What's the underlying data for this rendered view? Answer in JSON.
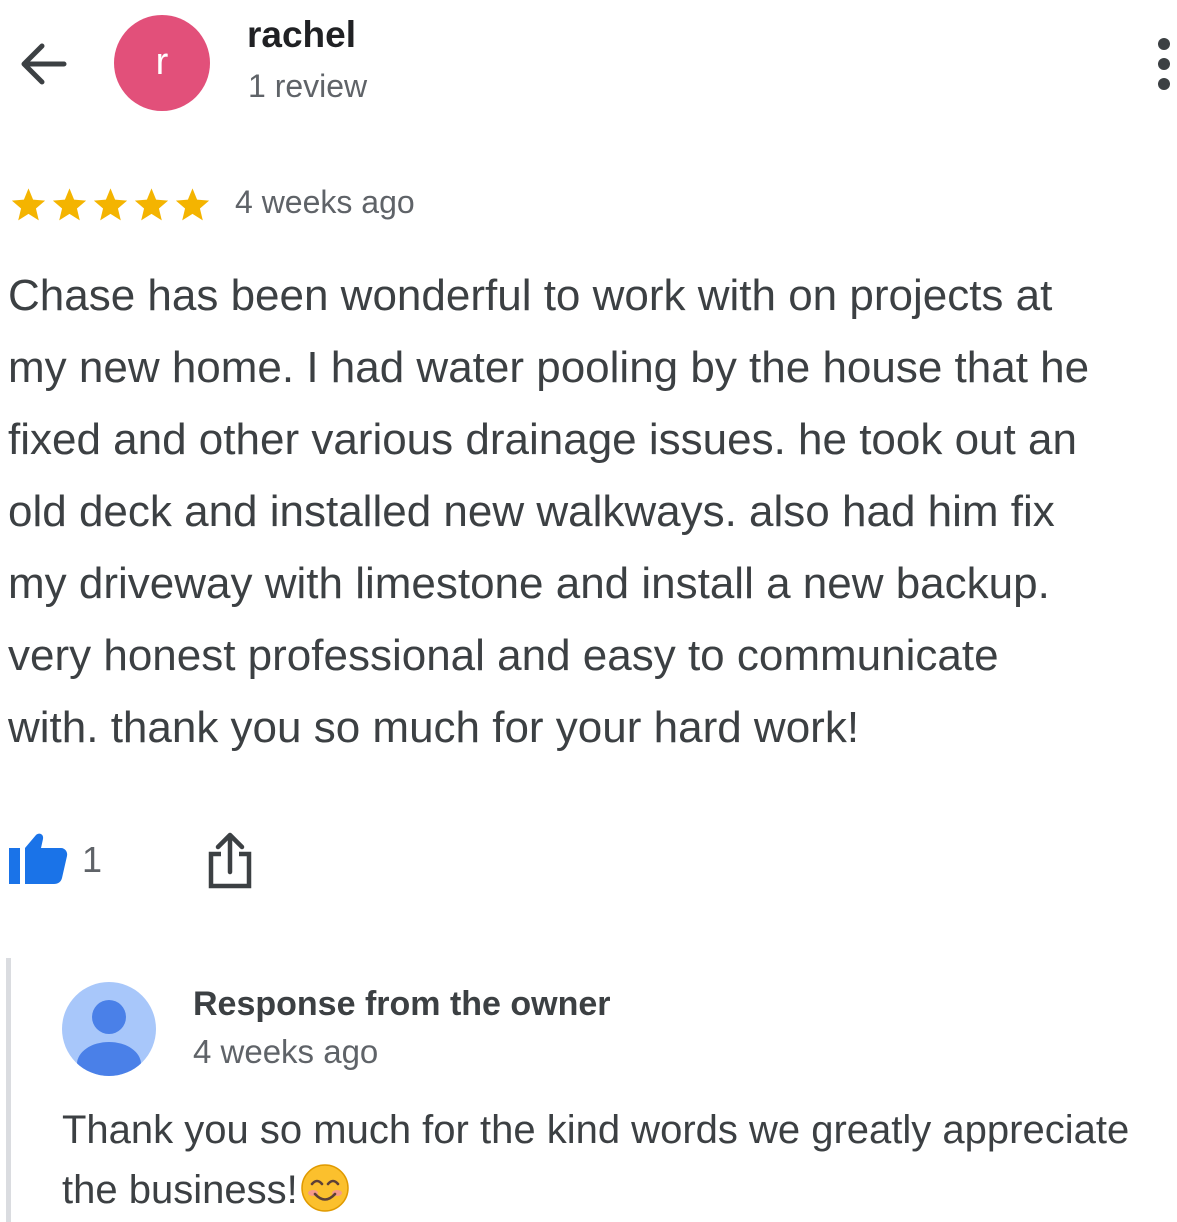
{
  "colors": {
    "avatar_bg": "#e2507a",
    "star": "#f4b400",
    "like_blue": "#1a73e8",
    "text_dark": "#202124",
    "text_body": "#3c4043",
    "text_muted": "#5f6368"
  },
  "header": {
    "back_icon": "arrow-back-icon",
    "avatar_letter": "r",
    "user_name": "rachel",
    "review_count": "1 review",
    "menu_icon": "more-vert-icon"
  },
  "review": {
    "rating": 5,
    "rating_max": 5,
    "date": "4 weeks ago",
    "text_lines": [
      "Chase has been wonderful to work with on projects at",
      "my new home. I had water pooling by the house that he",
      "fixed and other various drainage issues. he took out an",
      "old deck and installed new walkways. also had him fix",
      "my driveway with limestone and install a new backup.",
      "very honest professional and easy to communicate",
      "with. thank you so much for your hard work!"
    ],
    "like_icon": "thumb-up-icon",
    "like_count": "1",
    "share_icon": "share-icon"
  },
  "owner_response": {
    "avatar_icon": "person-avatar-icon",
    "title": "Response from the owner",
    "date": "4 weeks ago",
    "text_lines": [
      "Thank you so much for the kind words we greatly appreciate",
      "the business!"
    ],
    "emoji_icon": "smiling-face-emoji-icon"
  }
}
